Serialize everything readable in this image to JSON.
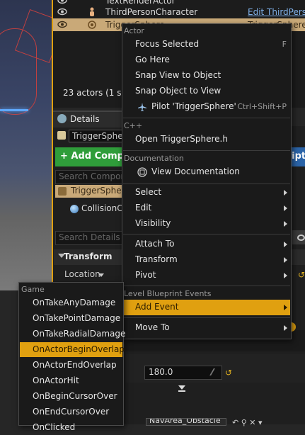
{
  "outliner": {
    "rows": [
      {
        "name": "TextRenderActor",
        "type": ""
      },
      {
        "name": "ThirdPersonCharacter",
        "type": "Edit ThirdPers"
      },
      {
        "name": "TriggerSphere",
        "type": "TriggerSphere"
      }
    ],
    "actor_count": "23 actors (1 sel"
  },
  "details": {
    "tab_label": "Details",
    "name_value": "TriggerSphe",
    "add_component_label": "+ Add Compo",
    "blueprint_label": "cript",
    "search_components_placeholder": "Search Compone",
    "root_component": "TriggerSphere",
    "child_component": "CollisionCo",
    "search_details_placeholder": "Search Details",
    "transform_header": "Transform",
    "location_label": "Location",
    "scale_value": "180.0",
    "nav_value": "NavArea_Obstacle"
  },
  "context_menu": {
    "sections": [
      {
        "header": "Actor",
        "items": [
          {
            "label": "Focus Selected",
            "shortcut": "F"
          },
          {
            "label": "Go Here",
            "shortcut": ""
          },
          {
            "label": "Snap View to Object",
            "shortcut": ""
          },
          {
            "label": "Snap Object to View",
            "shortcut": ""
          },
          {
            "label": "Pilot 'TriggerSphere'",
            "shortcut": "Ctrl+Shift+P"
          }
        ]
      },
      {
        "header": "C++",
        "items": [
          {
            "label": "Open TriggerSphere.h",
            "shortcut": ""
          }
        ]
      },
      {
        "header": "Documentation",
        "items": [
          {
            "label": "View Documentation",
            "shortcut": ""
          }
        ]
      }
    ],
    "groups": [
      [
        "Select",
        "Edit",
        "Visibility"
      ],
      [
        "Attach To",
        "Transform",
        "Pivot"
      ]
    ],
    "level_header": "Level Blueprint Events",
    "add_event": "Add Event",
    "move_to": "Move To"
  },
  "game_menu": {
    "header": "Game",
    "items": [
      "OnTakeAnyDamage",
      "OnTakePointDamage",
      "OnTakeRadialDamage",
      "OnActorBeginOverlap",
      "OnActorEndOverlap",
      "OnActorHit",
      "OnBeginCursorOver",
      "OnEndCursorOver",
      "OnClicked"
    ],
    "highlighted": "OnActorBeginOverlap"
  },
  "colors": {
    "accent": "#e0a010",
    "selection": "#c9a978",
    "add_button": "#2f9d3a",
    "blueprint_button": "#2b64a8"
  },
  "icons": [
    "eye-icon",
    "character-icon",
    "trigger-icon",
    "details-icon",
    "airplane-icon",
    "documentation-icon",
    "submenu-arrow-icon",
    "reset-arrow-icon"
  ]
}
